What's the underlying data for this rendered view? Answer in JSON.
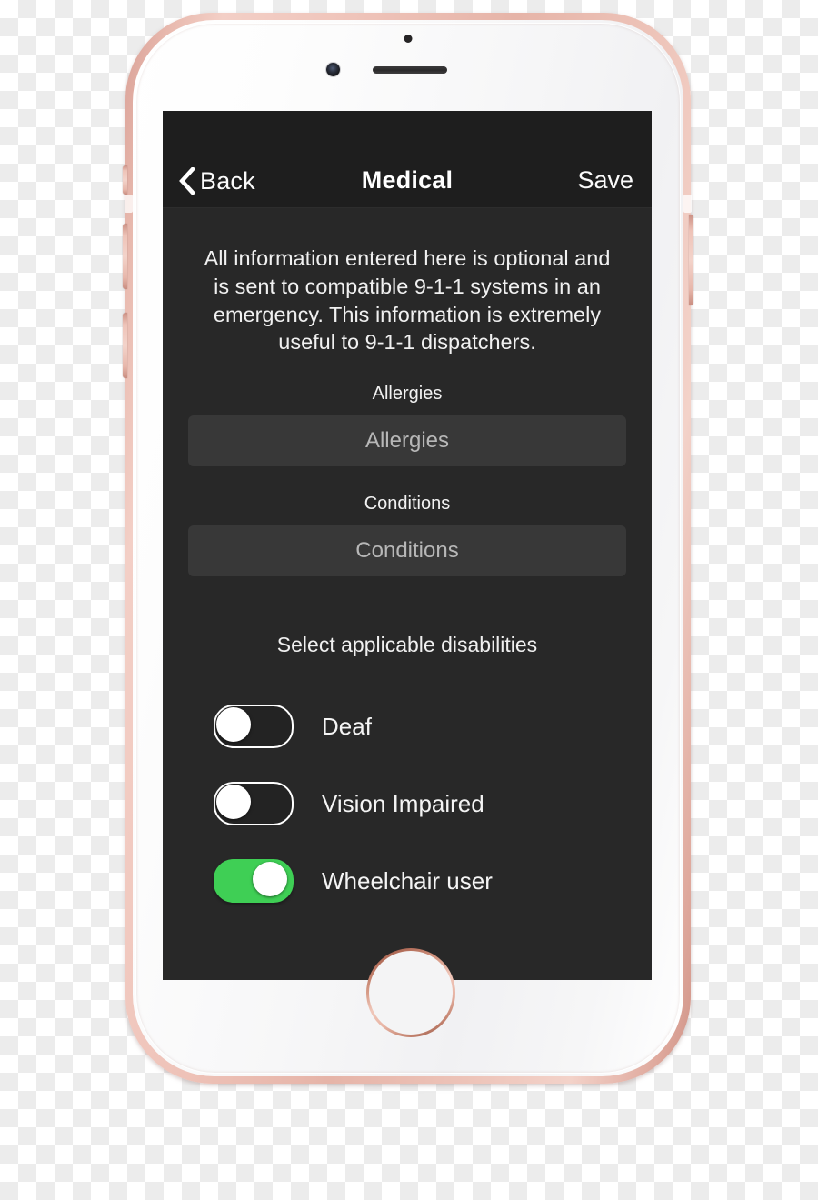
{
  "device": {
    "type": "smartphone",
    "frame_color": "#eec3b8",
    "frame_color_name": "rose-gold",
    "front_color": "#f7f7f8",
    "hardware": {
      "front_camera": "camera-icon",
      "earpiece": "speaker-slot",
      "proximity_sensor": "sensor-dot",
      "home_button": "home-button",
      "volume_up": "volume-up-button",
      "volume_down": "volume-down-button",
      "mute_switch": "mute-switch",
      "power": "power-button"
    }
  },
  "screen": {
    "background": "#282828",
    "navbar": {
      "background": "#1e1e1e",
      "back_icon": "chevron-left-icon",
      "back_label": "Back",
      "title": "Medical",
      "save_label": "Save"
    },
    "intro": {
      "text": "All information entered here is optional and is sent to compatible 9-1-1 systems in an emergency. This information is extremely useful to 9-1-1 dispatchers."
    },
    "fields": [
      {
        "id": "allergies",
        "label": "Allergies",
        "placeholder": "Allergies",
        "value": ""
      },
      {
        "id": "conditions",
        "label": "Conditions",
        "placeholder": "Conditions",
        "value": ""
      }
    ],
    "disabilities": {
      "section_title": "Select applicable disabilities",
      "on_color": "#3fcf55",
      "items": [
        {
          "id": "deaf",
          "label": "Deaf",
          "state": "off",
          "state_label": "Off"
        },
        {
          "id": "vision-impaired",
          "label": "Vision Impaired",
          "state": "off",
          "state_label": "Off"
        },
        {
          "id": "wheelchair-user",
          "label": "Wheelchair user",
          "state": "on",
          "state_label": "On"
        }
      ]
    }
  }
}
